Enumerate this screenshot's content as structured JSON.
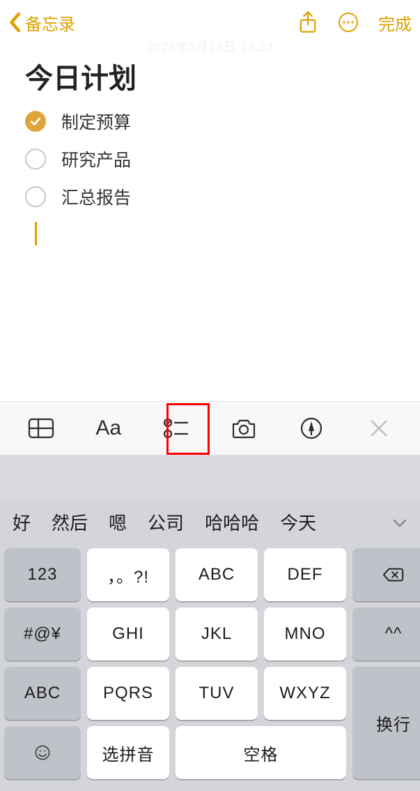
{
  "nav": {
    "back_label": "备忘录",
    "done_label": "完成"
  },
  "date_stamp": "2023年5月15日 14:32",
  "note": {
    "title": "今日计划",
    "items": [
      {
        "text": "制定预算",
        "checked": true
      },
      {
        "text": "研究产品",
        "checked": false
      },
      {
        "text": "汇总报告",
        "checked": false
      }
    ]
  },
  "fmt_toolbar": {
    "aa_label": "Aa"
  },
  "keyboard": {
    "candidates": [
      "好",
      "然后",
      "嗯",
      "公司",
      "哈哈哈",
      "今天"
    ],
    "keys": {
      "num": "123",
      "punct": "，。?!",
      "abc": "ABC",
      "def": "DEF",
      "sym": "#@¥",
      "ghi": "GHI",
      "jkl": "JKL",
      "mno": "MNO",
      "face": "^^",
      "shift": "ABC",
      "pqrs": "PQRS",
      "tuv": "TUV",
      "wxyz": "WXYZ",
      "enter": "换行",
      "emoji": "☺",
      "pinyin": "选拼音",
      "space": "空格"
    }
  }
}
